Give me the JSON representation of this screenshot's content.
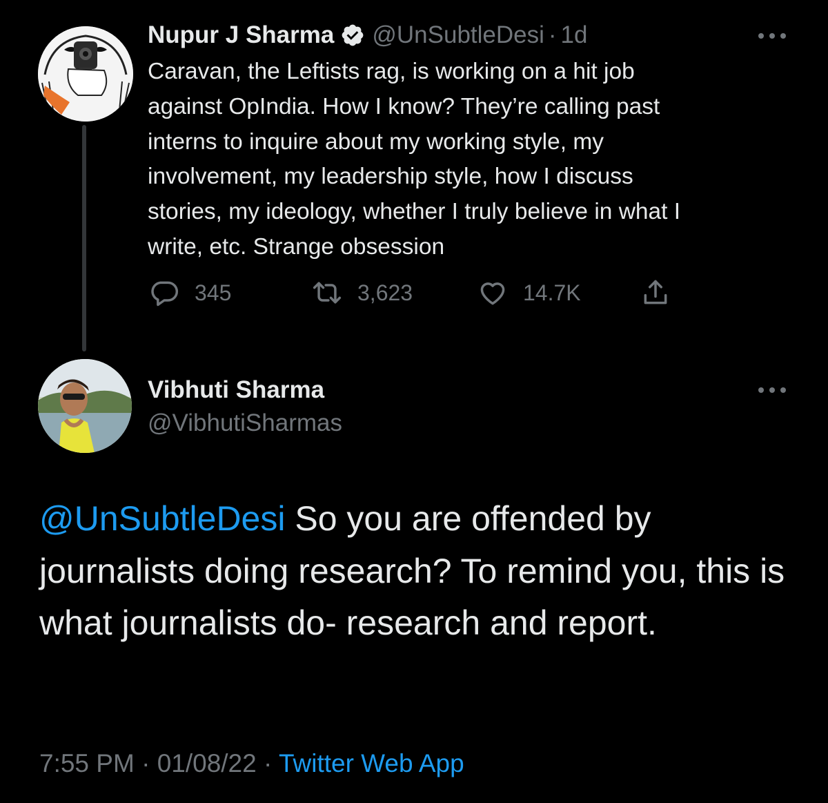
{
  "parent_tweet": {
    "display_name": "Nupur J Sharma",
    "handle": "@UnSubtleDesi",
    "separator": "·",
    "time_ago": "1d",
    "verified": true,
    "text": "Caravan, the Leftists rag, is working on a hit job\nagainst OpIndia. How I know? They’re calling past\ninterns to inquire about my working style, my\ninvolvement, my leadership style, how I discuss\nstories, my ideology, whether I truly believe in what I\nwrite, etc. Strange obsession",
    "actions": {
      "replies": "345",
      "retweets": "3,623",
      "likes": "14.7K"
    },
    "icons": {
      "verified": "verified-badge-icon",
      "more": "more-options-icon",
      "reply": "reply-icon",
      "retweet": "retweet-icon",
      "like": "heart-icon",
      "share": "share-icon"
    }
  },
  "reply_tweet": {
    "display_name": "Vibhuti Sharma",
    "handle": "@VibhutiSharmas",
    "mention": "@UnSubtleDesi",
    "text": " So you are offended by journalists doing research? To remind you, this is what journalists do- research and report.",
    "time": "7:55 PM",
    "separator_1": " · ",
    "date": "01/08/22",
    "separator_2": " · ",
    "source": "Twitter Web App"
  },
  "colors": {
    "background": "#000000",
    "text_primary": "#e7e9ea",
    "text_secondary": "#71767b",
    "accent": "#1d9bf0",
    "thread_line": "#333639"
  }
}
